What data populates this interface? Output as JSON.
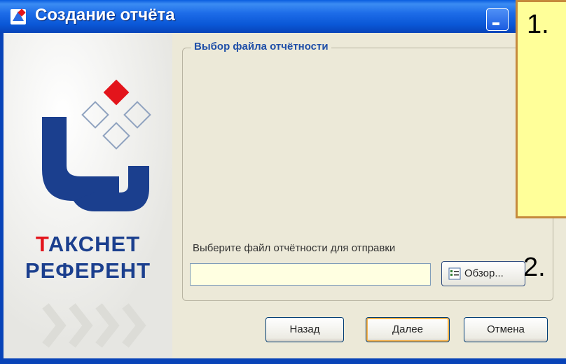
{
  "window": {
    "title": "Создание отчёта"
  },
  "branding": {
    "line1_red": "Т",
    "line1_blue": "АКСНЕТ",
    "line2": "РЕФЕРЕНТ"
  },
  "group": {
    "title": "Выбор файла отчётности"
  },
  "file": {
    "label": "Выберите файл отчётности для отправки",
    "value": "",
    "browse_label": "Обзор..."
  },
  "buttons": {
    "back": "Назад",
    "next": "Далее",
    "cancel": "Отмена"
  },
  "annotations": {
    "one": "1.",
    "two": "2."
  },
  "colors": {
    "titlebar": "#0a57d6",
    "brand_blue": "#1b3f8e",
    "brand_red": "#e3141b",
    "input_bg": "#ffffe1",
    "note_bg": "#ffff99",
    "note_border": "#c58a3c"
  }
}
